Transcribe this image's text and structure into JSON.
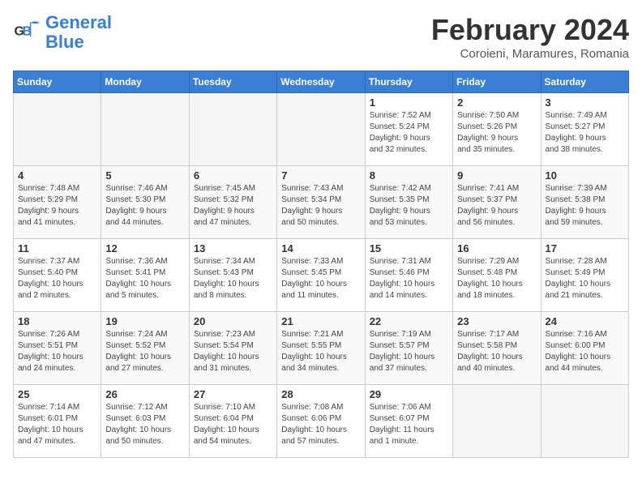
{
  "logo": {
    "text_general": "General",
    "text_blue": "Blue"
  },
  "header": {
    "month_title": "February 2024",
    "subtitle": "Coroieni, Maramures, Romania"
  },
  "weekdays": [
    "Sunday",
    "Monday",
    "Tuesday",
    "Wednesday",
    "Thursday",
    "Friday",
    "Saturday"
  ],
  "weeks": [
    [
      {
        "day": "",
        "info": ""
      },
      {
        "day": "",
        "info": ""
      },
      {
        "day": "",
        "info": ""
      },
      {
        "day": "",
        "info": ""
      },
      {
        "day": "1",
        "info": "Sunrise: 7:52 AM\nSunset: 5:24 PM\nDaylight: 9 hours\nand 32 minutes."
      },
      {
        "day": "2",
        "info": "Sunrise: 7:50 AM\nSunset: 5:26 PM\nDaylight: 9 hours\nand 35 minutes."
      },
      {
        "day": "3",
        "info": "Sunrise: 7:49 AM\nSunset: 5:27 PM\nDaylight: 9 hours\nand 38 minutes."
      }
    ],
    [
      {
        "day": "4",
        "info": "Sunrise: 7:48 AM\nSunset: 5:29 PM\nDaylight: 9 hours\nand 41 minutes."
      },
      {
        "day": "5",
        "info": "Sunrise: 7:46 AM\nSunset: 5:30 PM\nDaylight: 9 hours\nand 44 minutes."
      },
      {
        "day": "6",
        "info": "Sunrise: 7:45 AM\nSunset: 5:32 PM\nDaylight: 9 hours\nand 47 minutes."
      },
      {
        "day": "7",
        "info": "Sunrise: 7:43 AM\nSunset: 5:34 PM\nDaylight: 9 hours\nand 50 minutes."
      },
      {
        "day": "8",
        "info": "Sunrise: 7:42 AM\nSunset: 5:35 PM\nDaylight: 9 hours\nand 53 minutes."
      },
      {
        "day": "9",
        "info": "Sunrise: 7:41 AM\nSunset: 5:37 PM\nDaylight: 9 hours\nand 56 minutes."
      },
      {
        "day": "10",
        "info": "Sunrise: 7:39 AM\nSunset: 5:38 PM\nDaylight: 9 hours\nand 59 minutes."
      }
    ],
    [
      {
        "day": "11",
        "info": "Sunrise: 7:37 AM\nSunset: 5:40 PM\nDaylight: 10 hours\nand 2 minutes."
      },
      {
        "day": "12",
        "info": "Sunrise: 7:36 AM\nSunset: 5:41 PM\nDaylight: 10 hours\nand 5 minutes."
      },
      {
        "day": "13",
        "info": "Sunrise: 7:34 AM\nSunset: 5:43 PM\nDaylight: 10 hours\nand 8 minutes."
      },
      {
        "day": "14",
        "info": "Sunrise: 7:33 AM\nSunset: 5:45 PM\nDaylight: 10 hours\nand 11 minutes."
      },
      {
        "day": "15",
        "info": "Sunrise: 7:31 AM\nSunset: 5:46 PM\nDaylight: 10 hours\nand 14 minutes."
      },
      {
        "day": "16",
        "info": "Sunrise: 7:29 AM\nSunset: 5:48 PM\nDaylight: 10 hours\nand 18 minutes."
      },
      {
        "day": "17",
        "info": "Sunrise: 7:28 AM\nSunset: 5:49 PM\nDaylight: 10 hours\nand 21 minutes."
      }
    ],
    [
      {
        "day": "18",
        "info": "Sunrise: 7:26 AM\nSunset: 5:51 PM\nDaylight: 10 hours\nand 24 minutes."
      },
      {
        "day": "19",
        "info": "Sunrise: 7:24 AM\nSunset: 5:52 PM\nDaylight: 10 hours\nand 27 minutes."
      },
      {
        "day": "20",
        "info": "Sunrise: 7:23 AM\nSunset: 5:54 PM\nDaylight: 10 hours\nand 31 minutes."
      },
      {
        "day": "21",
        "info": "Sunrise: 7:21 AM\nSunset: 5:55 PM\nDaylight: 10 hours\nand 34 minutes."
      },
      {
        "day": "22",
        "info": "Sunrise: 7:19 AM\nSunset: 5:57 PM\nDaylight: 10 hours\nand 37 minutes."
      },
      {
        "day": "23",
        "info": "Sunrise: 7:17 AM\nSunset: 5:58 PM\nDaylight: 10 hours\nand 40 minutes."
      },
      {
        "day": "24",
        "info": "Sunrise: 7:16 AM\nSunset: 6:00 PM\nDaylight: 10 hours\nand 44 minutes."
      }
    ],
    [
      {
        "day": "25",
        "info": "Sunrise: 7:14 AM\nSunset: 6:01 PM\nDaylight: 10 hours\nand 47 minutes."
      },
      {
        "day": "26",
        "info": "Sunrise: 7:12 AM\nSunset: 6:03 PM\nDaylight: 10 hours\nand 50 minutes."
      },
      {
        "day": "27",
        "info": "Sunrise: 7:10 AM\nSunset: 6:04 PM\nDaylight: 10 hours\nand 54 minutes."
      },
      {
        "day": "28",
        "info": "Sunrise: 7:08 AM\nSunset: 6:06 PM\nDaylight: 10 hours\nand 57 minutes."
      },
      {
        "day": "29",
        "info": "Sunrise: 7:06 AM\nSunset: 6:07 PM\nDaylight: 11 hours\nand 1 minute."
      },
      {
        "day": "",
        "info": ""
      },
      {
        "day": "",
        "info": ""
      }
    ]
  ]
}
